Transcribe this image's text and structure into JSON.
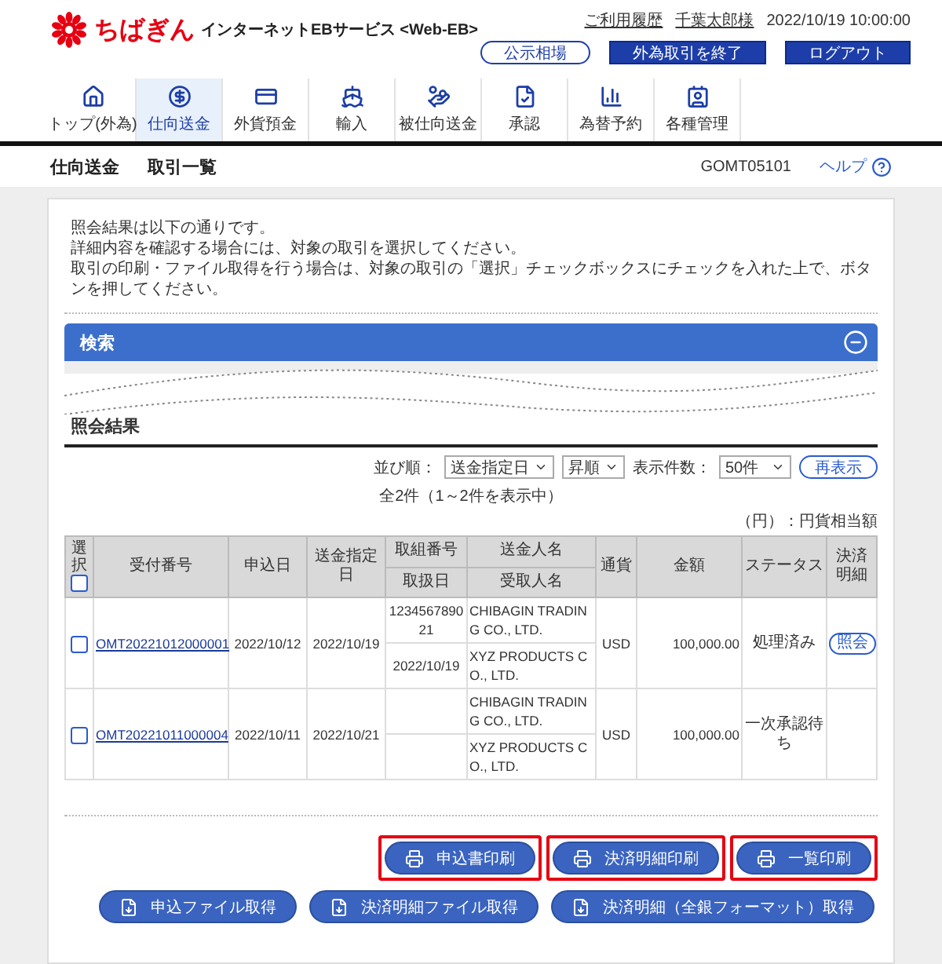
{
  "header": {
    "logo": "ちばぎん",
    "service": "インターネットEBサービス <Web-EB>",
    "links": [
      "ご利用履歴",
      "千葉太郎様"
    ],
    "datetime": "2022/10/19 10:00:00",
    "buttons": [
      {
        "label": "公示相場",
        "kind": "outline"
      },
      {
        "label": "外為取引を終了",
        "kind": "solid"
      },
      {
        "label": "ログアウト",
        "kind": "solid"
      }
    ]
  },
  "nav": [
    {
      "label": "トップ(外為)",
      "selected": false
    },
    {
      "label": "仕向送金",
      "selected": true
    },
    {
      "label": "外貨預金",
      "selected": false
    },
    {
      "label": "輸入",
      "selected": false
    },
    {
      "label": "被仕向送金",
      "selected": false
    },
    {
      "label": "承認",
      "selected": false
    },
    {
      "label": "為替予約",
      "selected": false
    },
    {
      "label": "各種管理",
      "selected": false
    }
  ],
  "breadcrumb": [
    "仕向送金",
    "取引一覧"
  ],
  "screen_id": "GOMT05101",
  "help": "ヘルプ",
  "intro": [
    "照会結果は以下の通りです。",
    "詳細内容を確認する場合には、対象の取引を選択してください。",
    "取引の印刷・ファイル取得を行う場合は、対象の取引の「選択」チェックボックスにチェックを入れた上で、ボタンを押してください。"
  ],
  "search": {
    "title": "検索",
    "expanded": true
  },
  "results": {
    "title": "照会結果",
    "sort_label": "並び順：",
    "sort_field": "送金指定日",
    "sort_order": "昇順",
    "count_label": "表示件数：",
    "count": "50件",
    "refresh": "再表示",
    "summary": "全2件（1～2件を表示中）",
    "unit_note": "（円）：円貨相当額"
  },
  "table": {
    "columns": [
      "選択",
      "受付番号",
      "申込日",
      "送金指定日",
      "取組番号",
      "取扱日",
      "送金人名",
      "受取人名",
      "通貨",
      "金額",
      "ステータス",
      "決済明細"
    ],
    "all_checked": false,
    "rows": [
      {
        "checked": false,
        "receipt_no": "OMT20221012000001",
        "applied": "2022/10/12",
        "value_date": "2022/10/19",
        "deal_no": "123456789021",
        "handled": "2022/10/19",
        "sender": "CHIBAGIN TRADING CO., LTD.",
        "recipient": "XYZ PRODUCTS CO., LTD.",
        "currency": "USD",
        "amount": "100,000.00",
        "status": "処理済み",
        "action": "照会"
      },
      {
        "checked": false,
        "receipt_no": "OMT20221011000004",
        "applied": "2022/10/11",
        "value_date": "2022/10/21",
        "sender": "CHIBAGIN TRADING CO., LTD.",
        "recipient": "XYZ PRODUCTS CO., LTD.",
        "currency": "USD",
        "amount": "100,000.00",
        "status": "一次承認待ち"
      }
    ]
  },
  "print_buttons": [
    {
      "label": "申込書印刷",
      "highlighted": true
    },
    {
      "label": "決済明細印刷",
      "highlighted": true
    },
    {
      "label": "一覧印刷",
      "highlighted": true
    }
  ],
  "file_buttons": [
    {
      "label": "申込ファイル取得"
    },
    {
      "label": "決済明細ファイル取得"
    },
    {
      "label": "決済明細（全銀フォーマット）取得"
    }
  ]
}
